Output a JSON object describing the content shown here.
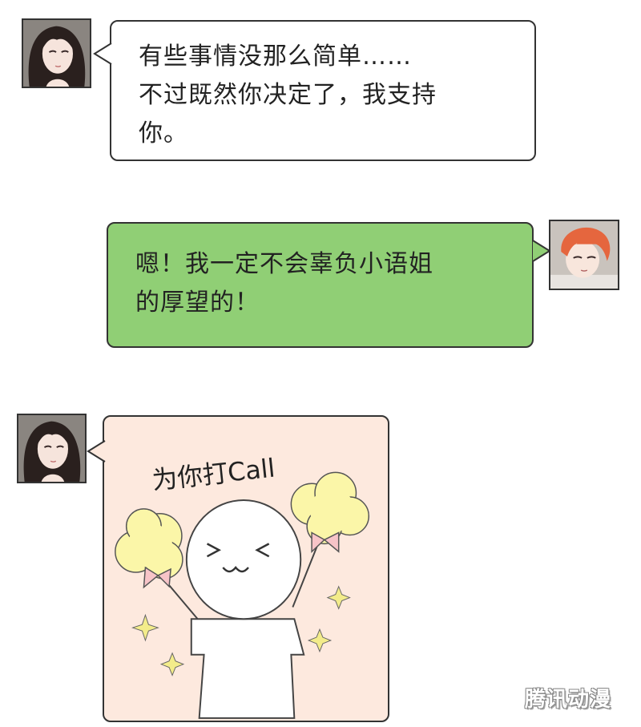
{
  "messages": [
    {
      "speaker": "left",
      "text": "有些事情没那么简单……\n不过既然你决定了，我支持\n你。"
    },
    {
      "speaker": "right",
      "text": "嗯！我一定不会辜负小语姐\n的厚望的！"
    },
    {
      "speaker": "left",
      "sticker_caption": "为你打Call"
    }
  ],
  "watermark": "腾讯动漫",
  "colors": {
    "left_bubble": "#ffffff",
    "right_bubble": "#90cf75",
    "sticker_bg": "#fde9de",
    "pompom": "#fbf6a8",
    "bow": "#f7c4c8",
    "sparkle": "#f3ec8a"
  }
}
